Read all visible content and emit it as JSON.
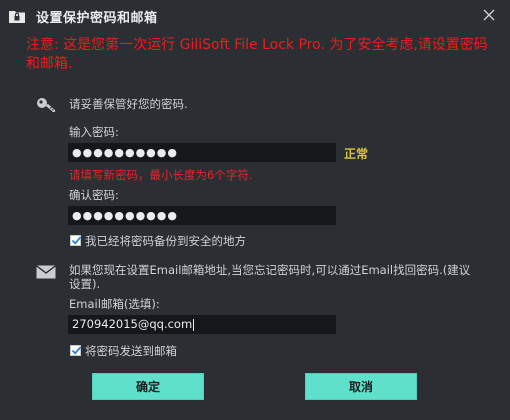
{
  "window": {
    "title": "设置保护密码和邮箱"
  },
  "warning": {
    "text": "注意: 这是您第一次运行 GiliSoft File Lock Pro. 为了安全考虑,请设置密码和邮箱."
  },
  "password_section": {
    "intro": "请妥善保管好您的密码.",
    "enter_label": "输入密码:",
    "password_value": "●●●●●●●●●●",
    "strength": "正常",
    "hint": "请填写新密码，最小长度为6个字符.",
    "confirm_label": "确认密码:",
    "confirm_value": "●●●●●●●●●●",
    "backup_check": {
      "label": "我已经将密码备份到安全的地方",
      "checked": true
    }
  },
  "email_section": {
    "intro_line1": "如果您现在设置Email邮箱地址,当您忘记密码时,可以通过Email找回密码.(建议",
    "intro_line2": "设置).",
    "email_label": "Email邮箱(选填):",
    "email_value": "270942015@qq.com",
    "send_check": {
      "label": "将密码发送到邮箱",
      "checked": true
    }
  },
  "buttons": {
    "ok": "确定",
    "cancel": "取消"
  },
  "colors": {
    "accent": "#5fe0cb",
    "warning": "#ee1c1c",
    "strength": "#d8c43b",
    "background": "#2b2f33"
  },
  "icons": {
    "app": "folder-lock-icon",
    "close": "close-icon",
    "key": "key-icon",
    "mail": "mail-icon",
    "check": "checkmark-icon"
  }
}
